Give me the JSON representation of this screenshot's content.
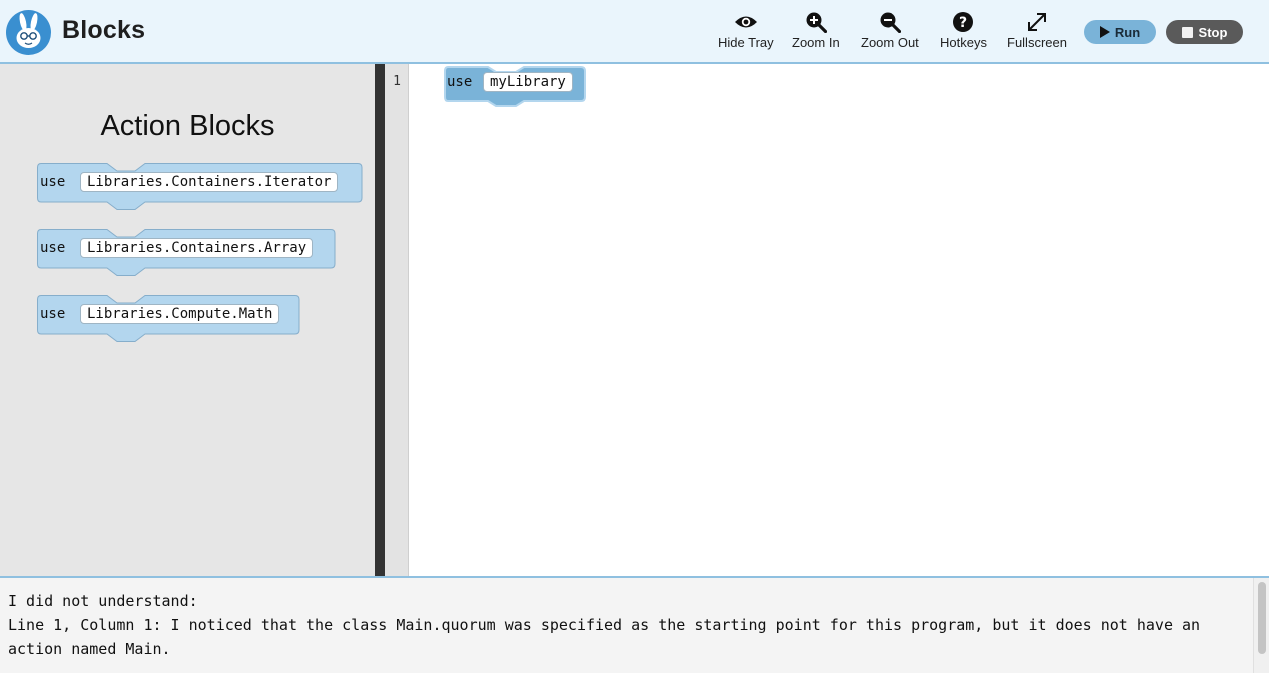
{
  "header": {
    "title": "Blocks",
    "logo_icon": "bunny-logo-icon"
  },
  "toolbar": {
    "hide_tray": "Hide Tray",
    "zoom_in": "Zoom In",
    "zoom_out": "Zoom Out",
    "hotkeys": "Hotkeys",
    "fullscreen": "Fullscreen",
    "run": "Run",
    "stop": "Stop"
  },
  "tray": {
    "title": "Action Blocks",
    "blocks": [
      {
        "keyword": "use",
        "value": "Libraries.Containers.Iterator"
      },
      {
        "keyword": "use",
        "value": "Libraries.Containers.Array"
      },
      {
        "keyword": "use",
        "value": "Libraries.Compute.Math"
      }
    ]
  },
  "editor": {
    "line_numbers": [
      "1"
    ],
    "blocks": [
      {
        "keyword": "use",
        "value": "myLibrary"
      }
    ]
  },
  "output": {
    "lines": [
      "I did not understand:",
      "Line 1, Column 1: I noticed that the class Main.quorum was specified as the starting point for this program, but it does not have an action named Main."
    ]
  },
  "colors": {
    "header_bg": "#eaf5fc",
    "accent_border": "#8fc0e0",
    "block_fill": "#b3d6ee",
    "block_selected_fill": "#7ab3d8",
    "run_button": "#7ab3d8",
    "stop_button": "#5a5a5a",
    "tray_bg": "#e6e6e6",
    "splitter": "#333333"
  }
}
